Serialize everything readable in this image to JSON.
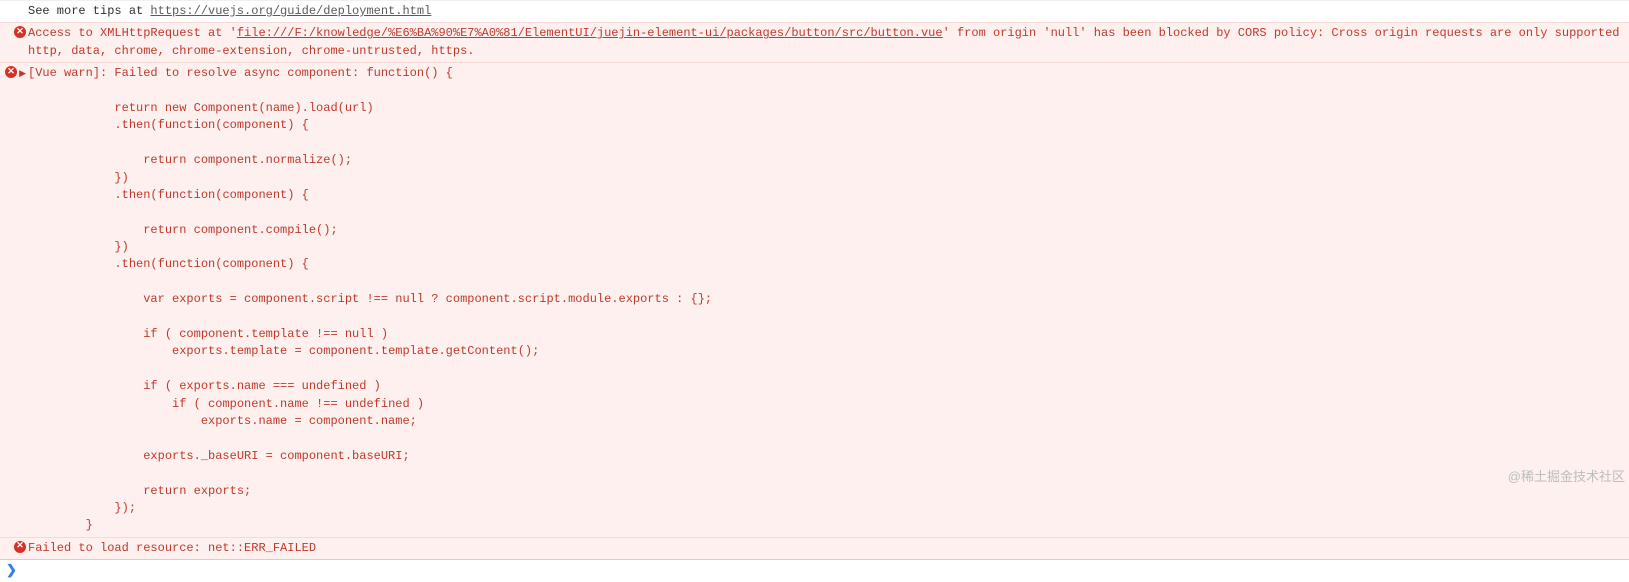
{
  "tip": {
    "prefix": "See more tips at ",
    "url": "https://vuejs.org/guide/deployment.html"
  },
  "cors": {
    "pre": "Access to XMLHttpRequest at '",
    "url": "file:///F:/knowledge/%E6%BA%90%E7%A0%81/ElementUI/juejin-element-ui/packages/button/src/button.vue",
    "post": "' from origin 'null' has been blocked by CORS policy: Cross origin requests are only supported http, data, chrome, chrome-extension, chrome-untrusted, https."
  },
  "vuewarn": "[Vue warn]: Failed to resolve async component: function() {\n\n            return new Component(name).load(url)\n            .then(function(component) {\n\n                return component.normalize();\n            })\n            .then(function(component) {\n\n                return component.compile();\n            })\n            .then(function(component) {\n\n                var exports = component.script !== null ? component.script.module.exports : {};\n\n                if ( component.template !== null )\n                    exports.template = component.template.getContent();\n\n                if ( exports.name === undefined )\n                    if ( component.name !== undefined )\n                        exports.name = component.name;\n\n                exports._baseURI = component.baseURI;\n\n                return exports;\n            });\n        }",
  "failload": "Failed to load resource: net::ERR_FAILED",
  "prompt": "❯",
  "watermark": "@稀土掘金技术社区"
}
